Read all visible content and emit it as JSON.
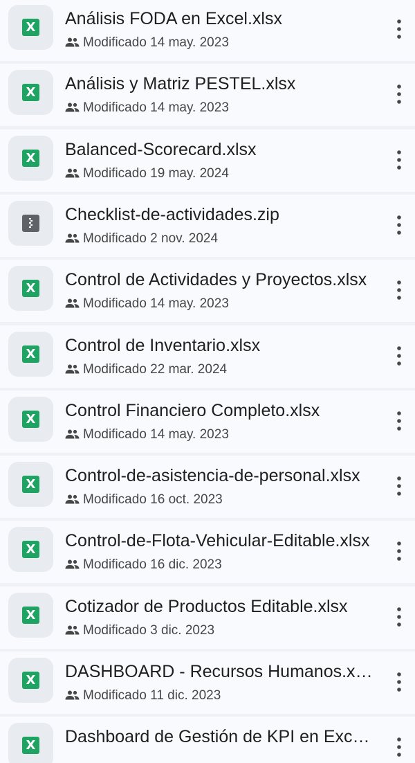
{
  "files": [
    {
      "name": "Análisis FODA en Excel.xlsx",
      "modified": "Modificado 14 may. 2023",
      "type": "sheet",
      "type_label": "X"
    },
    {
      "name": "Análisis y Matriz PESTEL.xlsx",
      "modified": "Modificado 14 may. 2023",
      "type": "sheet",
      "type_label": "X"
    },
    {
      "name": "Balanced-Scorecard.xlsx",
      "modified": "Modificado 19 may. 2024",
      "type": "sheet",
      "type_label": "X"
    },
    {
      "name": "Checklist-de-actividades.zip",
      "modified": "Modificado 2 nov. 2024",
      "type": "zip",
      "type_label": ""
    },
    {
      "name": "Control de Actividades y Proyectos.xlsx",
      "modified": "Modificado 14 may. 2023",
      "type": "sheet",
      "type_label": "X"
    },
    {
      "name": "Control de Inventario.xlsx",
      "modified": "Modificado 22 mar. 2024",
      "type": "sheet",
      "type_label": "X"
    },
    {
      "name": "Control Financiero Completo.xlsx",
      "modified": "Modificado 14 may. 2023",
      "type": "sheet",
      "type_label": "X"
    },
    {
      "name": "Control-de-asistencia-de-personal.xlsx",
      "modified": "Modificado 16 oct. 2023",
      "type": "sheet",
      "type_label": "X"
    },
    {
      "name": "Control-de-Flota-Vehicular-Editable.xlsx",
      "modified": "Modificado 16 dic. 2023",
      "type": "sheet",
      "type_label": "X"
    },
    {
      "name": "Cotizador de Productos Editable.xlsx",
      "modified": "Modificado 3 dic. 2023",
      "type": "sheet",
      "type_label": "X"
    },
    {
      "name": "DASHBOARD - Recursos Humanos.xlsx",
      "modified": "Modificado 11 dic. 2023",
      "type": "sheet",
      "type_label": "X"
    },
    {
      "name": "Dashboard de Gestión de KPI en Excel.xlsx",
      "modified": "",
      "type": "sheet",
      "type_label": "X"
    }
  ],
  "icons": {
    "sheet": "spreadsheet-icon",
    "zip": "zip-archive-icon",
    "shared": "shared-people-icon",
    "more": "more-vert-icon"
  },
  "colors": {
    "sheet_green": "#1ea362",
    "zip_gray": "#5f6368",
    "row_background": "#f8fafd",
    "divider": "#eef1f6",
    "thumb_background": "#e8ebef",
    "title_text": "#1f1f1f",
    "meta_text": "#444746"
  }
}
